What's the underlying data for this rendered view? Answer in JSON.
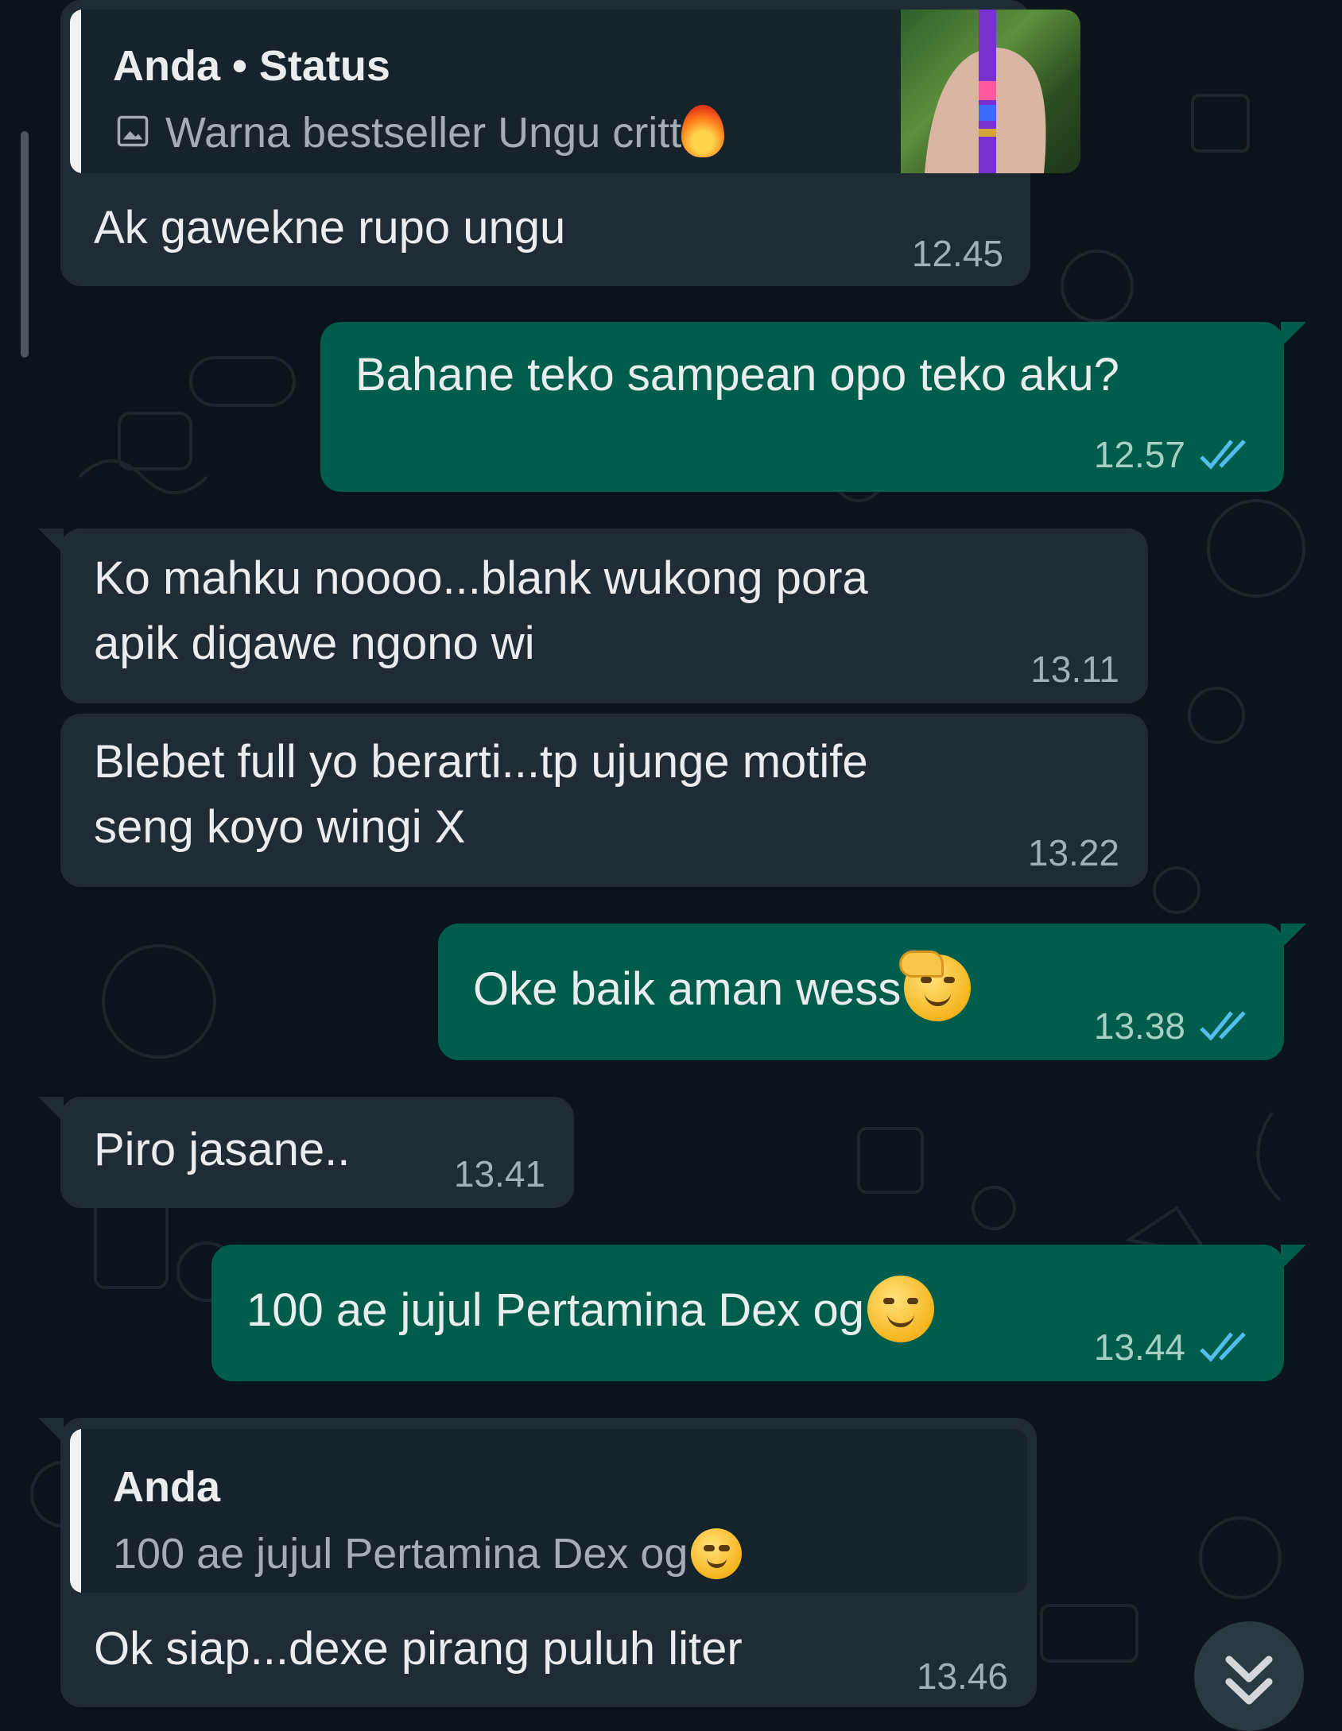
{
  "colors": {
    "background": "#0b141a",
    "incoming_bubble": "#202c33",
    "outgoing_bubble": "#005c4b",
    "read_ticks": "#53bdeb"
  },
  "messages": [
    {
      "direction": "incoming",
      "reply_to": {
        "title": "Anda • Status",
        "text": "Warna bestseller Ungu critt",
        "icon": "image-icon",
        "emoji": "fire",
        "has_thumbnail": true
      },
      "text": "Ak gawekne rupo ungu",
      "time": "12.45"
    },
    {
      "direction": "outgoing",
      "text": "Bahane teko sampean opo teko aku?",
      "time": "12.57",
      "status": "read"
    },
    {
      "direction": "incoming",
      "lines": [
        "Ko mahku noooo...blank wukong pora",
        "apik digawe ngono wi"
      ],
      "time": "13.11"
    },
    {
      "direction": "incoming",
      "lines": [
        "Blebet full yo berarti...tp ujunge motife",
        "seng koyo wingi X"
      ],
      "time": "13.22"
    },
    {
      "direction": "outgoing",
      "text": "Oke baik aman wess",
      "emoji": "saluting-face",
      "time": "13.38",
      "status": "read"
    },
    {
      "direction": "incoming",
      "text": "Piro jasane..",
      "time": "13.41"
    },
    {
      "direction": "outgoing",
      "text": "100 ae jujul Pertamina Dex og",
      "emoji": "smirking-face",
      "time": "13.44",
      "status": "read"
    },
    {
      "direction": "incoming",
      "reply_to": {
        "title": "Anda",
        "text": "100 ae jujul Pertamina Dex og",
        "emoji": "smirking-face"
      },
      "text": "Ok siap...dexe pirang puluh liter",
      "time": "13.46"
    }
  ],
  "scroll_down_icon": "double-chevron-down-icon"
}
